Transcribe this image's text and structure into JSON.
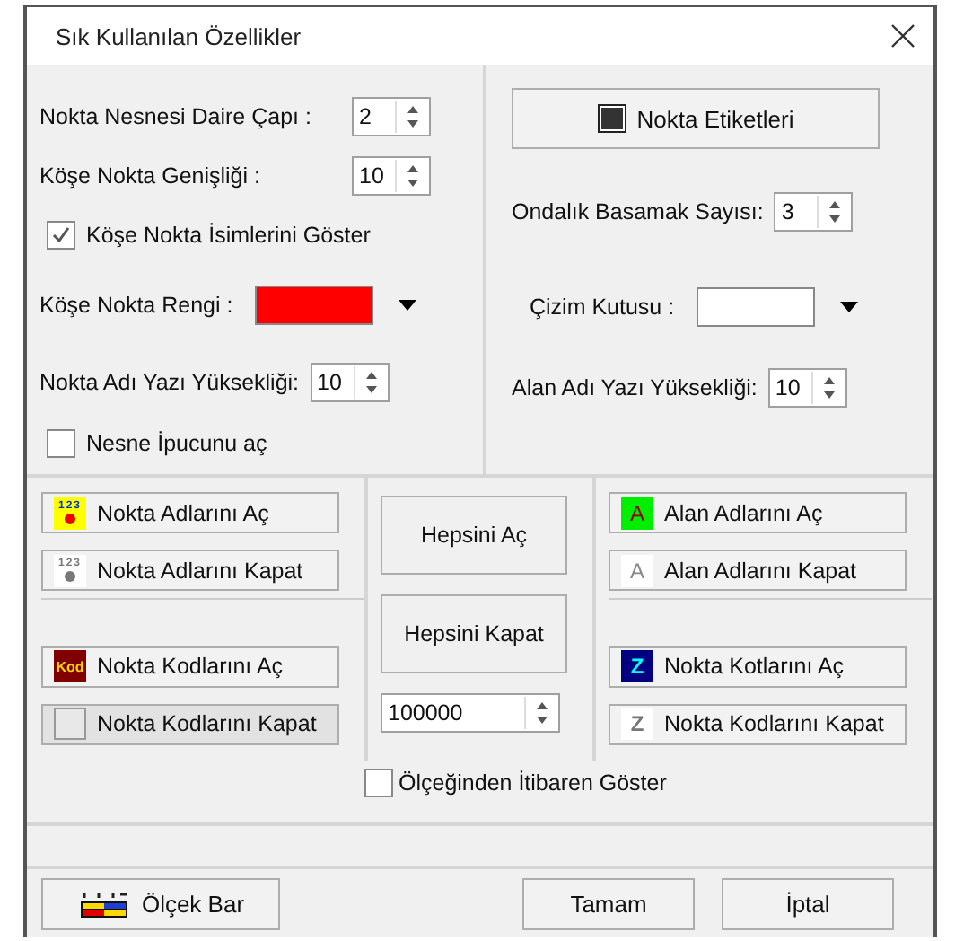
{
  "window": {
    "title": "Sık Kullanılan Özellikler"
  },
  "left_settings": [
    {
      "kind": "spin",
      "label": "Nokta Nesnesi Daire Çapı :",
      "value": "2"
    },
    {
      "kind": "spin",
      "label": "Köşe Nokta Genişliği :",
      "value": "10"
    },
    {
      "kind": "checkbox",
      "label": "Köşe Nokta İsimlerini Göster",
      "checked": true
    },
    {
      "kind": "color",
      "label": "Köşe Nokta Rengi :",
      "color": "#ff0000"
    },
    {
      "kind": "spin",
      "label": "Nokta Adı Yazı Yüksekliği:",
      "value": "10"
    },
    {
      "kind": "checkbox",
      "label": "Nesne İpucunu aç",
      "checked": false
    }
  ],
  "right_settings": [
    {
      "kind": "button",
      "label": "Nokta Etiketleri"
    },
    {
      "kind": "spin",
      "label": "Ondalık Basamak Sayısı:",
      "value": "3"
    },
    {
      "kind": "color",
      "label": "Çizim Kutusu :",
      "color": "#ffffff"
    },
    {
      "kind": "spin",
      "label": "Alan Adı Yazı Yüksekliği:",
      "value": "10"
    }
  ],
  "point_buttons": [
    {
      "kind": "names_on",
      "icon_text": "123",
      "label": "Nokta Adlarını Aç",
      "pressed": false
    },
    {
      "kind": "names_off",
      "icon_text": "123",
      "label": "Nokta Adlarını Kapat",
      "pressed": false
    },
    {
      "kind": "codes_on",
      "icon_text": "Kod",
      "label": "Nokta Kodlarını Aç",
      "pressed": false
    },
    {
      "kind": "codes_off",
      "label": "Nokta Kodlarını Kapat",
      "pressed": true
    }
  ],
  "middle": {
    "buttons": [
      "Hepsini Aç",
      "Hepsini Kapat"
    ],
    "scale_value": "100000",
    "scale_checkbox": {
      "label": "Ölçeğinden İtibaren Göster",
      "checked": false
    }
  },
  "area_buttons": [
    {
      "kind": "area_on",
      "icon_text": "A",
      "label": "Alan Adlarını Aç",
      "pressed": false
    },
    {
      "kind": "area_off",
      "icon_text": "A",
      "label": "Alan Adlarını Kapat",
      "pressed": false
    },
    {
      "kind": "elev_on",
      "icon_text": "Z",
      "label": "Nokta Kotlarını Aç",
      "pressed": false
    },
    {
      "kind": "elev_off",
      "icon_text": "Z",
      "label": "Nokta Kodlarını Kapat",
      "pressed": false
    }
  ],
  "footer": {
    "scale_bar": "Ölçek Bar",
    "ok": "Tamam",
    "cancel": "İptal"
  }
}
